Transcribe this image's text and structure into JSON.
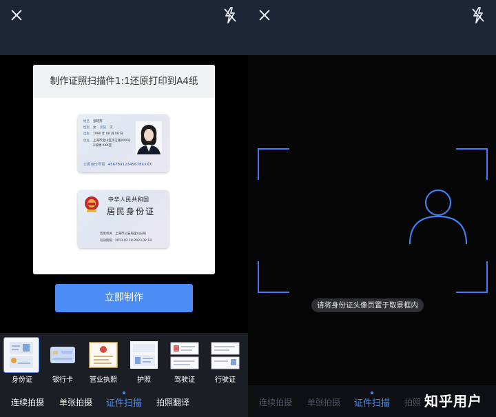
{
  "left": {
    "card_title": "制作证照扫描件1:1还原打印到A4纸",
    "id_front": {
      "name_label": "姓名",
      "name_value": "张晓燕",
      "sex_label": "性别",
      "sex_value": "女",
      "ethnic_label": "民族",
      "ethnic_value": "汉",
      "birth_label": "出生",
      "birth_value": "1990 年 08 月 08 日",
      "address_label": "住址",
      "address_value_1": "上海市宝山区滨江路XXX号",
      "address_value_2": "X号楼 XXX室",
      "idnum_label": "公民身份号码",
      "idnum_value": "45678912345678XXXX"
    },
    "id_back": {
      "title1": "中华人民共和国",
      "title2": "居民身份证",
      "authority_label": "签发机关",
      "authority_value": "上海市公安局宝山分局",
      "valid_label": "有效期限",
      "valid_value": "2013.02.18-2023.02.18"
    },
    "make_button": "立即制作",
    "doc_types": [
      {
        "label": "身份证",
        "selected": true
      },
      {
        "label": "银行卡"
      },
      {
        "label": "营业执照"
      },
      {
        "label": "护照"
      },
      {
        "label": "驾驶证"
      },
      {
        "label": "行驶证"
      }
    ],
    "tabs": [
      {
        "label": "连续拍摄"
      },
      {
        "label": "单张拍摄"
      },
      {
        "label": "证件扫描",
        "active": true
      },
      {
        "label": "拍照翻译"
      }
    ]
  },
  "right": {
    "hint": "请将身份证头像页置于取景框内",
    "tabs": [
      {
        "label": "连续拍摄"
      },
      {
        "label": "单张拍摄"
      },
      {
        "label": "证件扫描",
        "active": true
      },
      {
        "label": "拍照"
      }
    ],
    "watermark": "知乎用户"
  },
  "colors": {
    "accent": "#4a8cf6",
    "topbar": "#1e2636",
    "frame": "#3d7ef0"
  },
  "icons": {
    "close": "close-icon",
    "flash": "flash-off-icon",
    "person": "person-outline-icon"
  }
}
